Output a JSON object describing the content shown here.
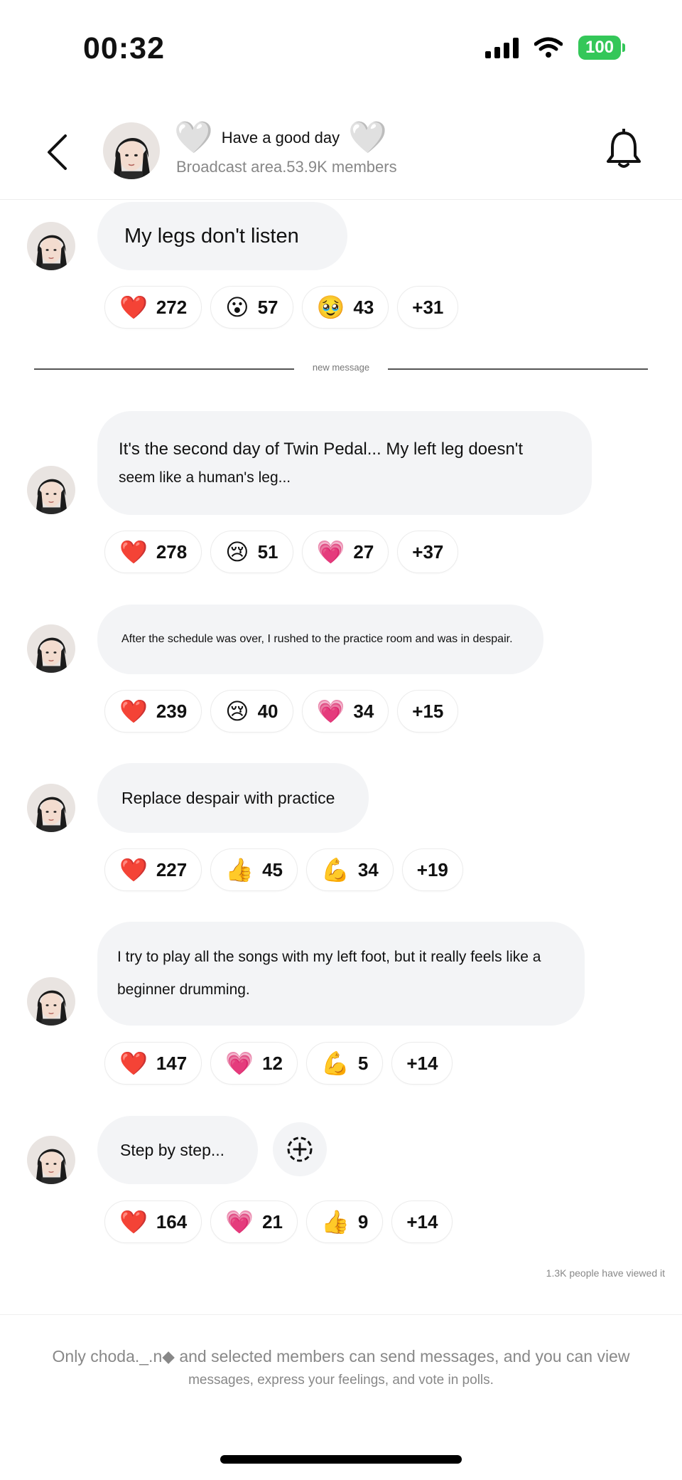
{
  "status_bar": {
    "time": "00:32",
    "battery": "100"
  },
  "header": {
    "title": "Have a good day",
    "subtitle": "Broadcast area.53.9K members",
    "title_emoji": "🤍"
  },
  "divider": {
    "label": "new message"
  },
  "messages": [
    {
      "text": "My legs don't listen",
      "reactions": [
        {
          "emoji": "❤️",
          "count": "272"
        },
        {
          "emoji": "😮",
          "count": "57"
        },
        {
          "emoji": "🥹",
          "count": "43"
        }
      ],
      "more": "+31"
    },
    {
      "text": "It's the second day of Twin Pedal... My left leg doesn't",
      "text2": "seem like a human's leg...",
      "reactions": [
        {
          "emoji": "❤️",
          "count": "278"
        },
        {
          "emoji": "😢",
          "count": "51"
        },
        {
          "emoji": "💗",
          "count": "27"
        }
      ],
      "more": "+37"
    },
    {
      "text": "After the schedule was over, I rushed to the practice room and was in despair.",
      "reactions": [
        {
          "emoji": "❤️",
          "count": "239"
        },
        {
          "emoji": "😢",
          "count": "40"
        },
        {
          "emoji": "💗",
          "count": "34"
        }
      ],
      "more": "+15"
    },
    {
      "text": "Replace despair with practice",
      "reactions": [
        {
          "emoji": "❤️",
          "count": "227"
        },
        {
          "emoji": "👍",
          "count": "45"
        },
        {
          "emoji": "💪",
          "count": "34"
        }
      ],
      "more": "+19"
    },
    {
      "text": "I try to play all the songs with my left foot, but it really feels like a",
      "text2": "beginner drumming.",
      "reactions": [
        {
          "emoji": "❤️",
          "count": "147"
        },
        {
          "emoji": "💗",
          "count": "12"
        },
        {
          "emoji": "💪",
          "count": "5"
        }
      ],
      "more": "+14"
    },
    {
      "text": "Step by step...",
      "reactions": [
        {
          "emoji": "❤️",
          "count": "164"
        },
        {
          "emoji": "💗",
          "count": "21"
        },
        {
          "emoji": "👍",
          "count": "9"
        }
      ],
      "more": "+14"
    }
  ],
  "viewed": "1.3K people have viewed it",
  "footer": {
    "line1": "Only choda._.n◆ and selected members can send messages, and you can view",
    "line2": "messages, express your feelings, and vote in polls."
  },
  "icons": {
    "back": "chevron-left-icon",
    "bell": "bell-icon",
    "add_reaction": "add-reaction-icon"
  },
  "colors": {
    "battery": "#34c759",
    "bubble": "#f3f4f6"
  }
}
